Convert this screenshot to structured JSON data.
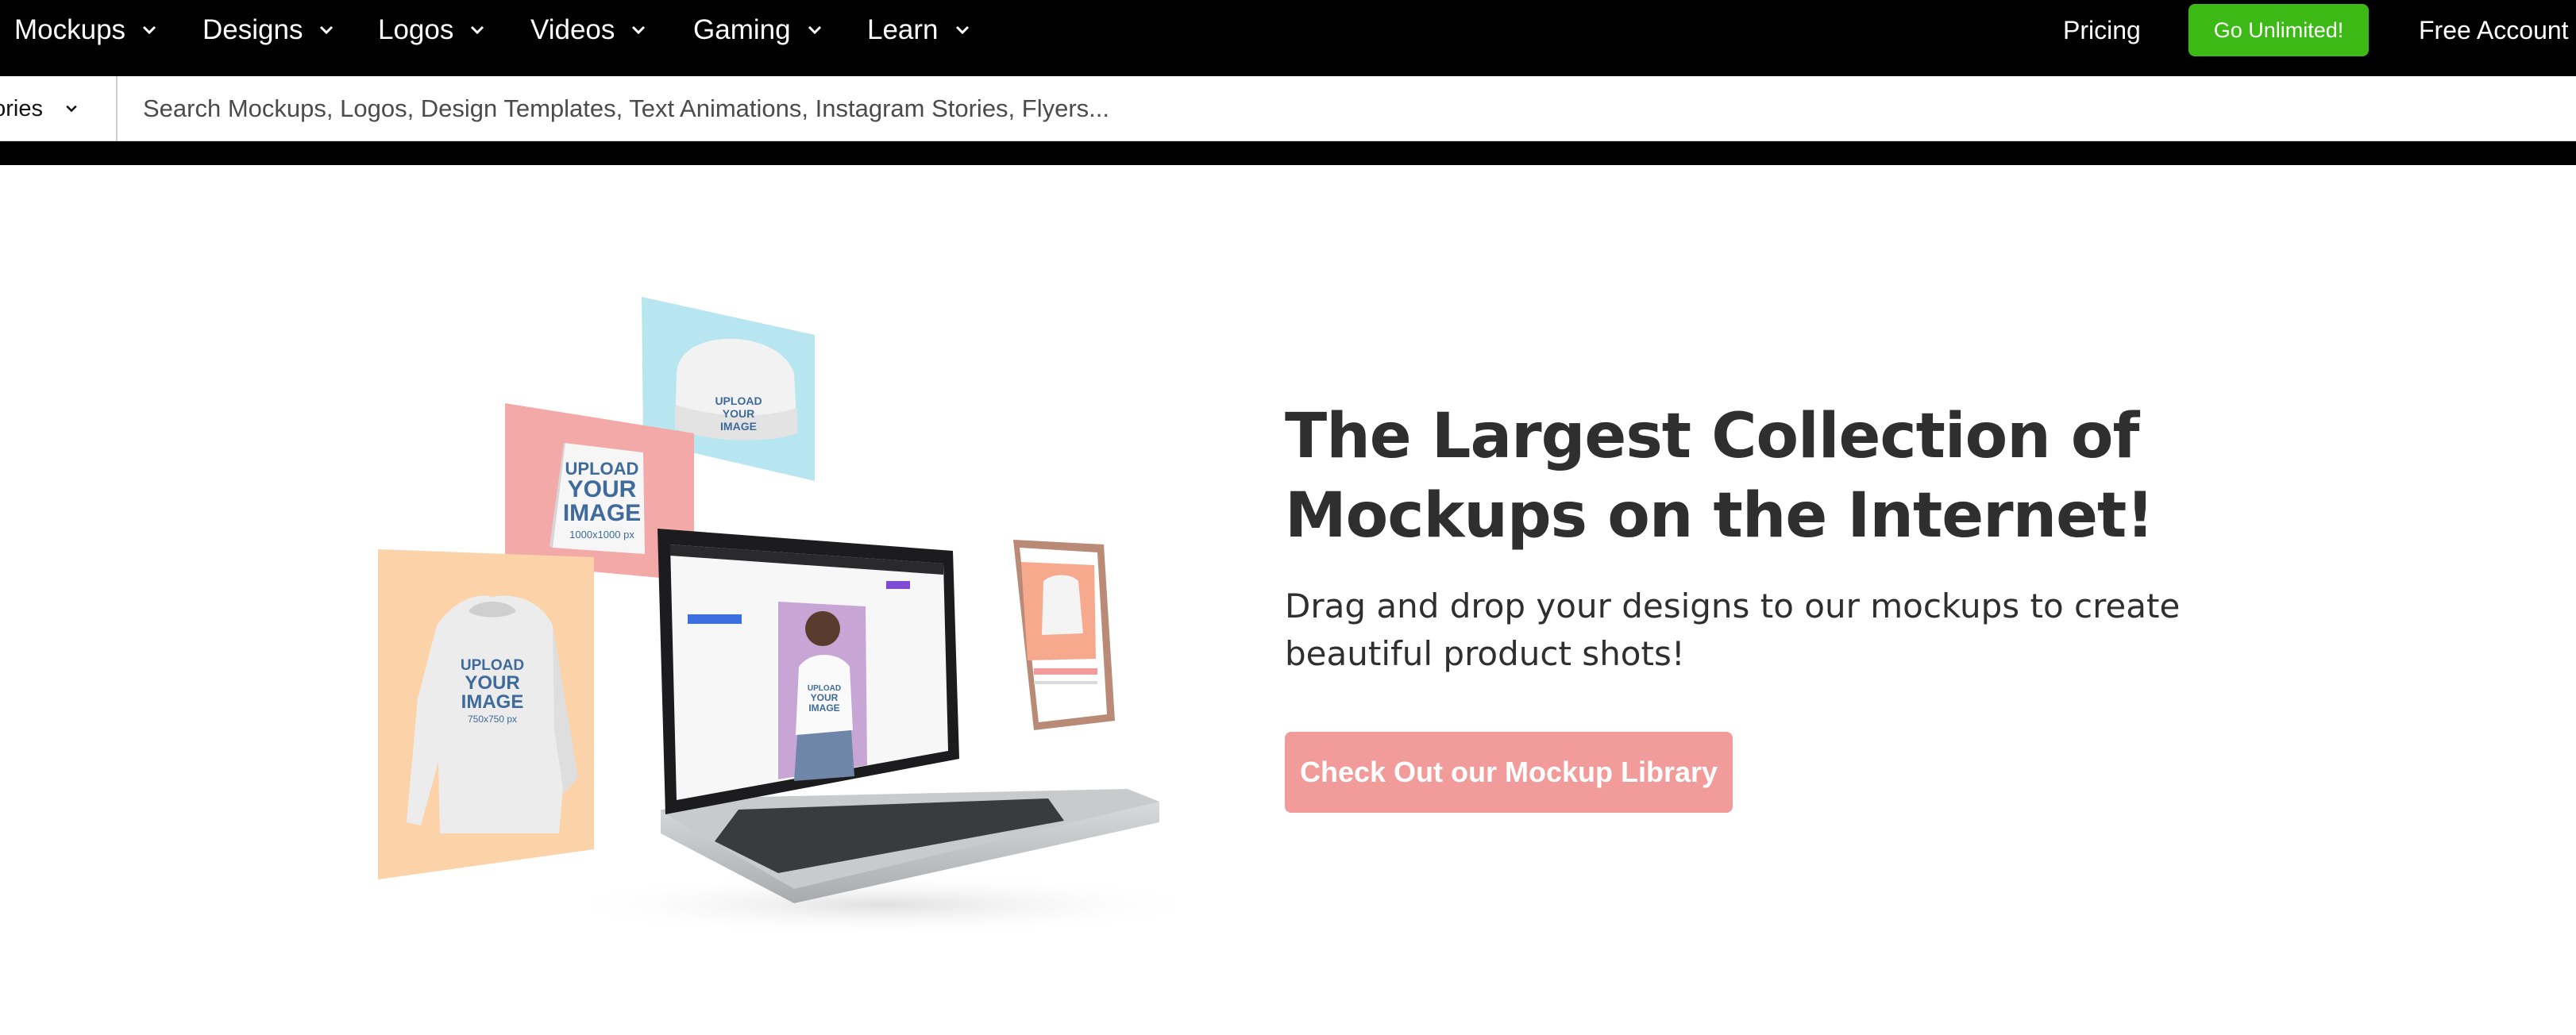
{
  "nav": {
    "items": [
      {
        "label": "Mockups"
      },
      {
        "label": "Designs"
      },
      {
        "label": "Logos"
      },
      {
        "label": "Videos"
      },
      {
        "label": "Gaming"
      },
      {
        "label": "Learn"
      }
    ],
    "pricing_label": "Pricing",
    "go_unlimited_label": "Go Unlimited!",
    "free_account_label": "Free Account"
  },
  "search": {
    "categories_label": "Categories",
    "placeholder": "Search Mockups, Logos, Design Templates, Text Animations, Instagram Stories, Flyers..."
  },
  "hero": {
    "title": "The Largest Collection of Mockups on the Internet!",
    "subtitle": "Drag and drop your designs to our mockups to create beautiful product shots!",
    "cta_label": "Check Out our Mockup Library",
    "mockup_overlay": {
      "line1": "UPLOAD",
      "line2": "YOUR",
      "line3": "IMAGE",
      "tote_size": "1000x1000 px",
      "hoodie_size": "750x750 px"
    }
  },
  "colors": {
    "nav_bg": "#000000",
    "go_unlimited_bg": "#3cb914",
    "cta_bg": "#f19c9b",
    "card_blue": "#b7e6f0",
    "card_pink": "#f4a9a9",
    "card_peach": "#fcd3a8",
    "model_bg": "#c7a6d6",
    "heading_text": "#2f2f2f"
  }
}
